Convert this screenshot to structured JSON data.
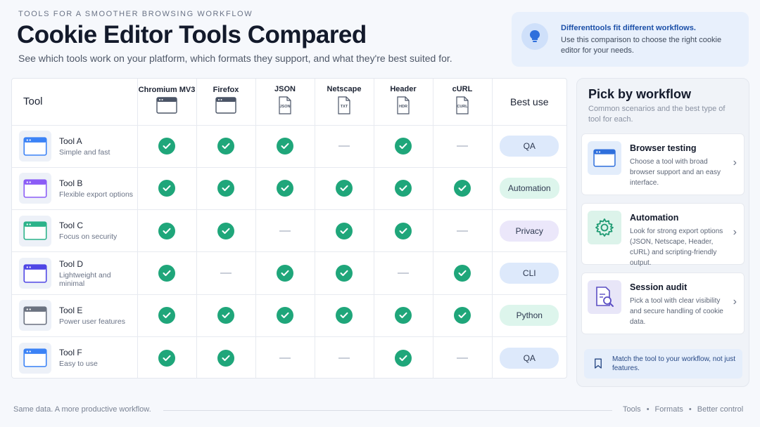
{
  "header": {
    "eyebrow": "TOOLS FOR A SMOOTHER BROWSING WORKFLOW",
    "title": "Cookie Editor Tools Compared",
    "subtitle": "See which tools work on your platform, which formats they support, and what they're best suited for."
  },
  "tip": {
    "title": "Differenttools fit different workflows.",
    "body": "Use this comparison to choose the right cookie editor for your needs.",
    "icon": "lightbulb-icon"
  },
  "table": {
    "tool_header": "Tool",
    "best_header": "Best use",
    "columns": [
      {
        "label": "Chromium MV3",
        "icon": "browser-window-icon",
        "badge": ""
      },
      {
        "label": "Firefox",
        "icon": "browser-window-icon",
        "badge": ""
      },
      {
        "label": "JSON",
        "icon": "file-icon",
        "badge": "JSON"
      },
      {
        "label": "Netscape",
        "icon": "file-icon",
        "badge": "TXT"
      },
      {
        "label": "Header",
        "icon": "file-icon",
        "badge": "HDR"
      },
      {
        "label": "cURL",
        "icon": "file-icon",
        "badge": "CURL"
      }
    ],
    "rows": [
      {
        "name": "Tool A",
        "desc": "Simple and fast",
        "support": [
          true,
          true,
          true,
          false,
          true,
          false
        ],
        "best": "QA",
        "accent": "#3b82f6",
        "pill": "#dde9fb"
      },
      {
        "name": "Tool B",
        "desc": "Flexible export options",
        "support": [
          true,
          true,
          true,
          true,
          true,
          true
        ],
        "best": "Automation",
        "accent": "#8b5cf6",
        "pill": "#ddf5ec"
      },
      {
        "name": "Tool C",
        "desc": "Focus on security",
        "support": [
          true,
          true,
          false,
          true,
          true,
          false
        ],
        "best": "Privacy",
        "accent": "#2bb38a",
        "pill": "#ebe7fa"
      },
      {
        "name": "Tool D",
        "desc": "Lightweight and minimal",
        "support": [
          true,
          false,
          true,
          true,
          false,
          true
        ],
        "best": "CLI",
        "accent": "#4f46e5",
        "pill": "#dde9fb"
      },
      {
        "name": "Tool E",
        "desc": "Power user features",
        "support": [
          true,
          true,
          true,
          true,
          true,
          true
        ],
        "best": "Python",
        "accent": "#6b7280",
        "pill": "#ddf5ec"
      },
      {
        "name": "Tool F",
        "desc": "Easy to use",
        "support": [
          true,
          true,
          false,
          false,
          true,
          false
        ],
        "best": "QA",
        "accent": "#3b82f6",
        "pill": "#dde9fb"
      }
    ]
  },
  "side": {
    "title": "Pick by workflow",
    "subtitle": "Common scenarios and the best type of tool for each.",
    "cards": [
      {
        "title": "Browser testing",
        "desc": "Choose a tool with broad browser support and an easy interface.",
        "icon": "browser-window-icon",
        "bg": "#e3edfb"
      },
      {
        "title": "Automation",
        "desc": "Look for strong export options (JSON, Netscape, Header, cURL) and scripting-friendly output.",
        "icon": "gear-icon",
        "bg": "#dcf3ea"
      },
      {
        "title": "Session audit",
        "desc": "Pick a tool with clear visibility and secure handling of cookie data.",
        "icon": "document-search-icon",
        "bg": "#e8e6f8"
      }
    ],
    "match": "Match the tool to your workflow, not just features.",
    "match_icon": "bookmark-icon"
  },
  "footer": {
    "left": "Same data. A more productive workflow.",
    "links": [
      "Tools",
      "Formats",
      "Better control"
    ]
  }
}
